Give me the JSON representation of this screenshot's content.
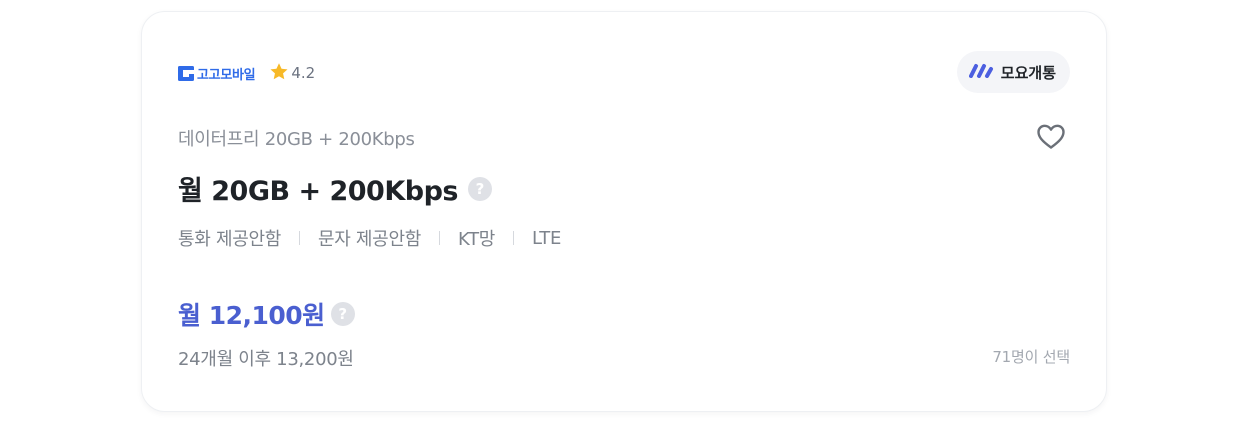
{
  "brand": {
    "name": "고고모바일",
    "icon": "brand-logo-icon",
    "color": "#2f6be8"
  },
  "rating": {
    "value": "4.2",
    "icon": "star-icon",
    "color": "#f7b928"
  },
  "carrier_badge": {
    "label": "모요개통",
    "icon": "moyo-logo-icon",
    "color": "#4c5fe0"
  },
  "plan": {
    "name": "데이터프리 20GB + 200Kbps",
    "headline": "월 20GB + 200Kbps"
  },
  "features": [
    "통화 제공안함",
    "문자 제공안함",
    "KT망",
    "LTE"
  ],
  "price": {
    "monthly": "월 12,100원",
    "after": "24개월 이후 13,200원",
    "color": "#4a5fd0"
  },
  "selected_count": "71명이 선택",
  "help_glyph": "?",
  "favorite": {
    "icon": "heart-outline-icon",
    "active": false
  }
}
